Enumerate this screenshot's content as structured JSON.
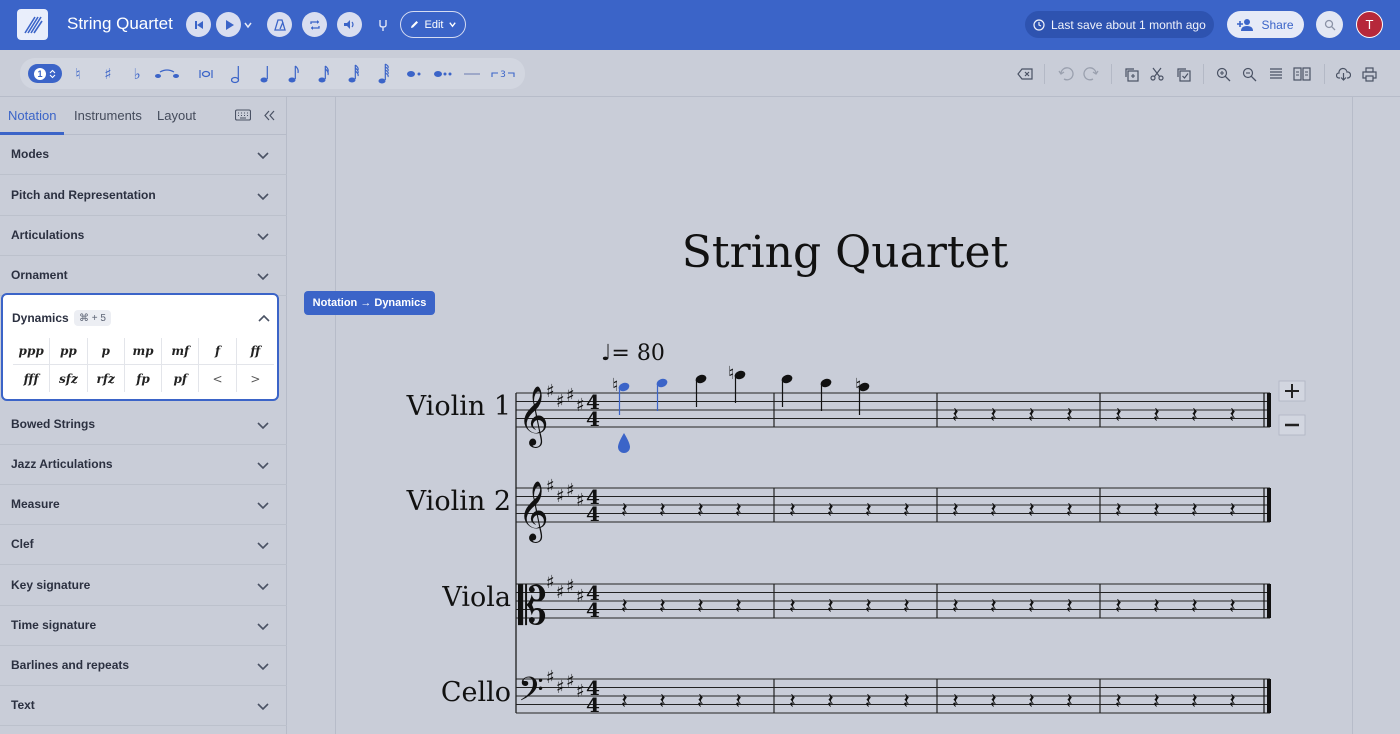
{
  "app": {
    "title": "String Quartet",
    "edit_label": "Edit",
    "save_status": "Last save about 1 month ago",
    "share_label": "Share",
    "avatar_initial": "T",
    "accent": "#3b64c8"
  },
  "toolbar": {
    "voice": "1",
    "note_tools": [
      "natural",
      "sharp",
      "flat",
      "tie",
      "breve",
      "half-note",
      "quarter-note",
      "eighth-note",
      "16th-note",
      "32nd-note",
      "64th-note",
      "dot",
      "double-dot",
      "rest",
      "tuplet"
    ],
    "right_tools": [
      "delete",
      "undo",
      "redo",
      "copy",
      "cut",
      "paste",
      "zoom-in",
      "zoom-out",
      "view-list",
      "view-page",
      "download",
      "print"
    ]
  },
  "sidebar": {
    "tabs": [
      {
        "label": "Notation"
      },
      {
        "label": "Instruments"
      },
      {
        "label": "Layout"
      }
    ],
    "sections": [
      {
        "label": "Modes"
      },
      {
        "label": "Pitch and Representation"
      },
      {
        "label": "Articulations"
      },
      {
        "label": "Ornament"
      },
      {
        "label": "Dynamics"
      },
      {
        "label": "Bowed Strings"
      },
      {
        "label": "Jazz Articulations"
      },
      {
        "label": "Measure"
      },
      {
        "label": "Clef"
      },
      {
        "label": "Key signature"
      },
      {
        "label": "Time signature"
      },
      {
        "label": "Barlines and repeats"
      },
      {
        "label": "Text"
      }
    ],
    "dynamics_shortcut": "⌘ + 5",
    "dynamics": [
      "ppp",
      "pp",
      "p",
      "mp",
      "mf",
      "f",
      "ff",
      "fff",
      "sfz",
      "rfz",
      "fp",
      "pf",
      "<",
      ">"
    ]
  },
  "tooltip": "Notation → Dynamics",
  "score": {
    "title": "String Quartet",
    "tempo": "= 80",
    "instruments": [
      "Violin 1",
      "Violin 2",
      "Viola",
      "Cello"
    ]
  }
}
